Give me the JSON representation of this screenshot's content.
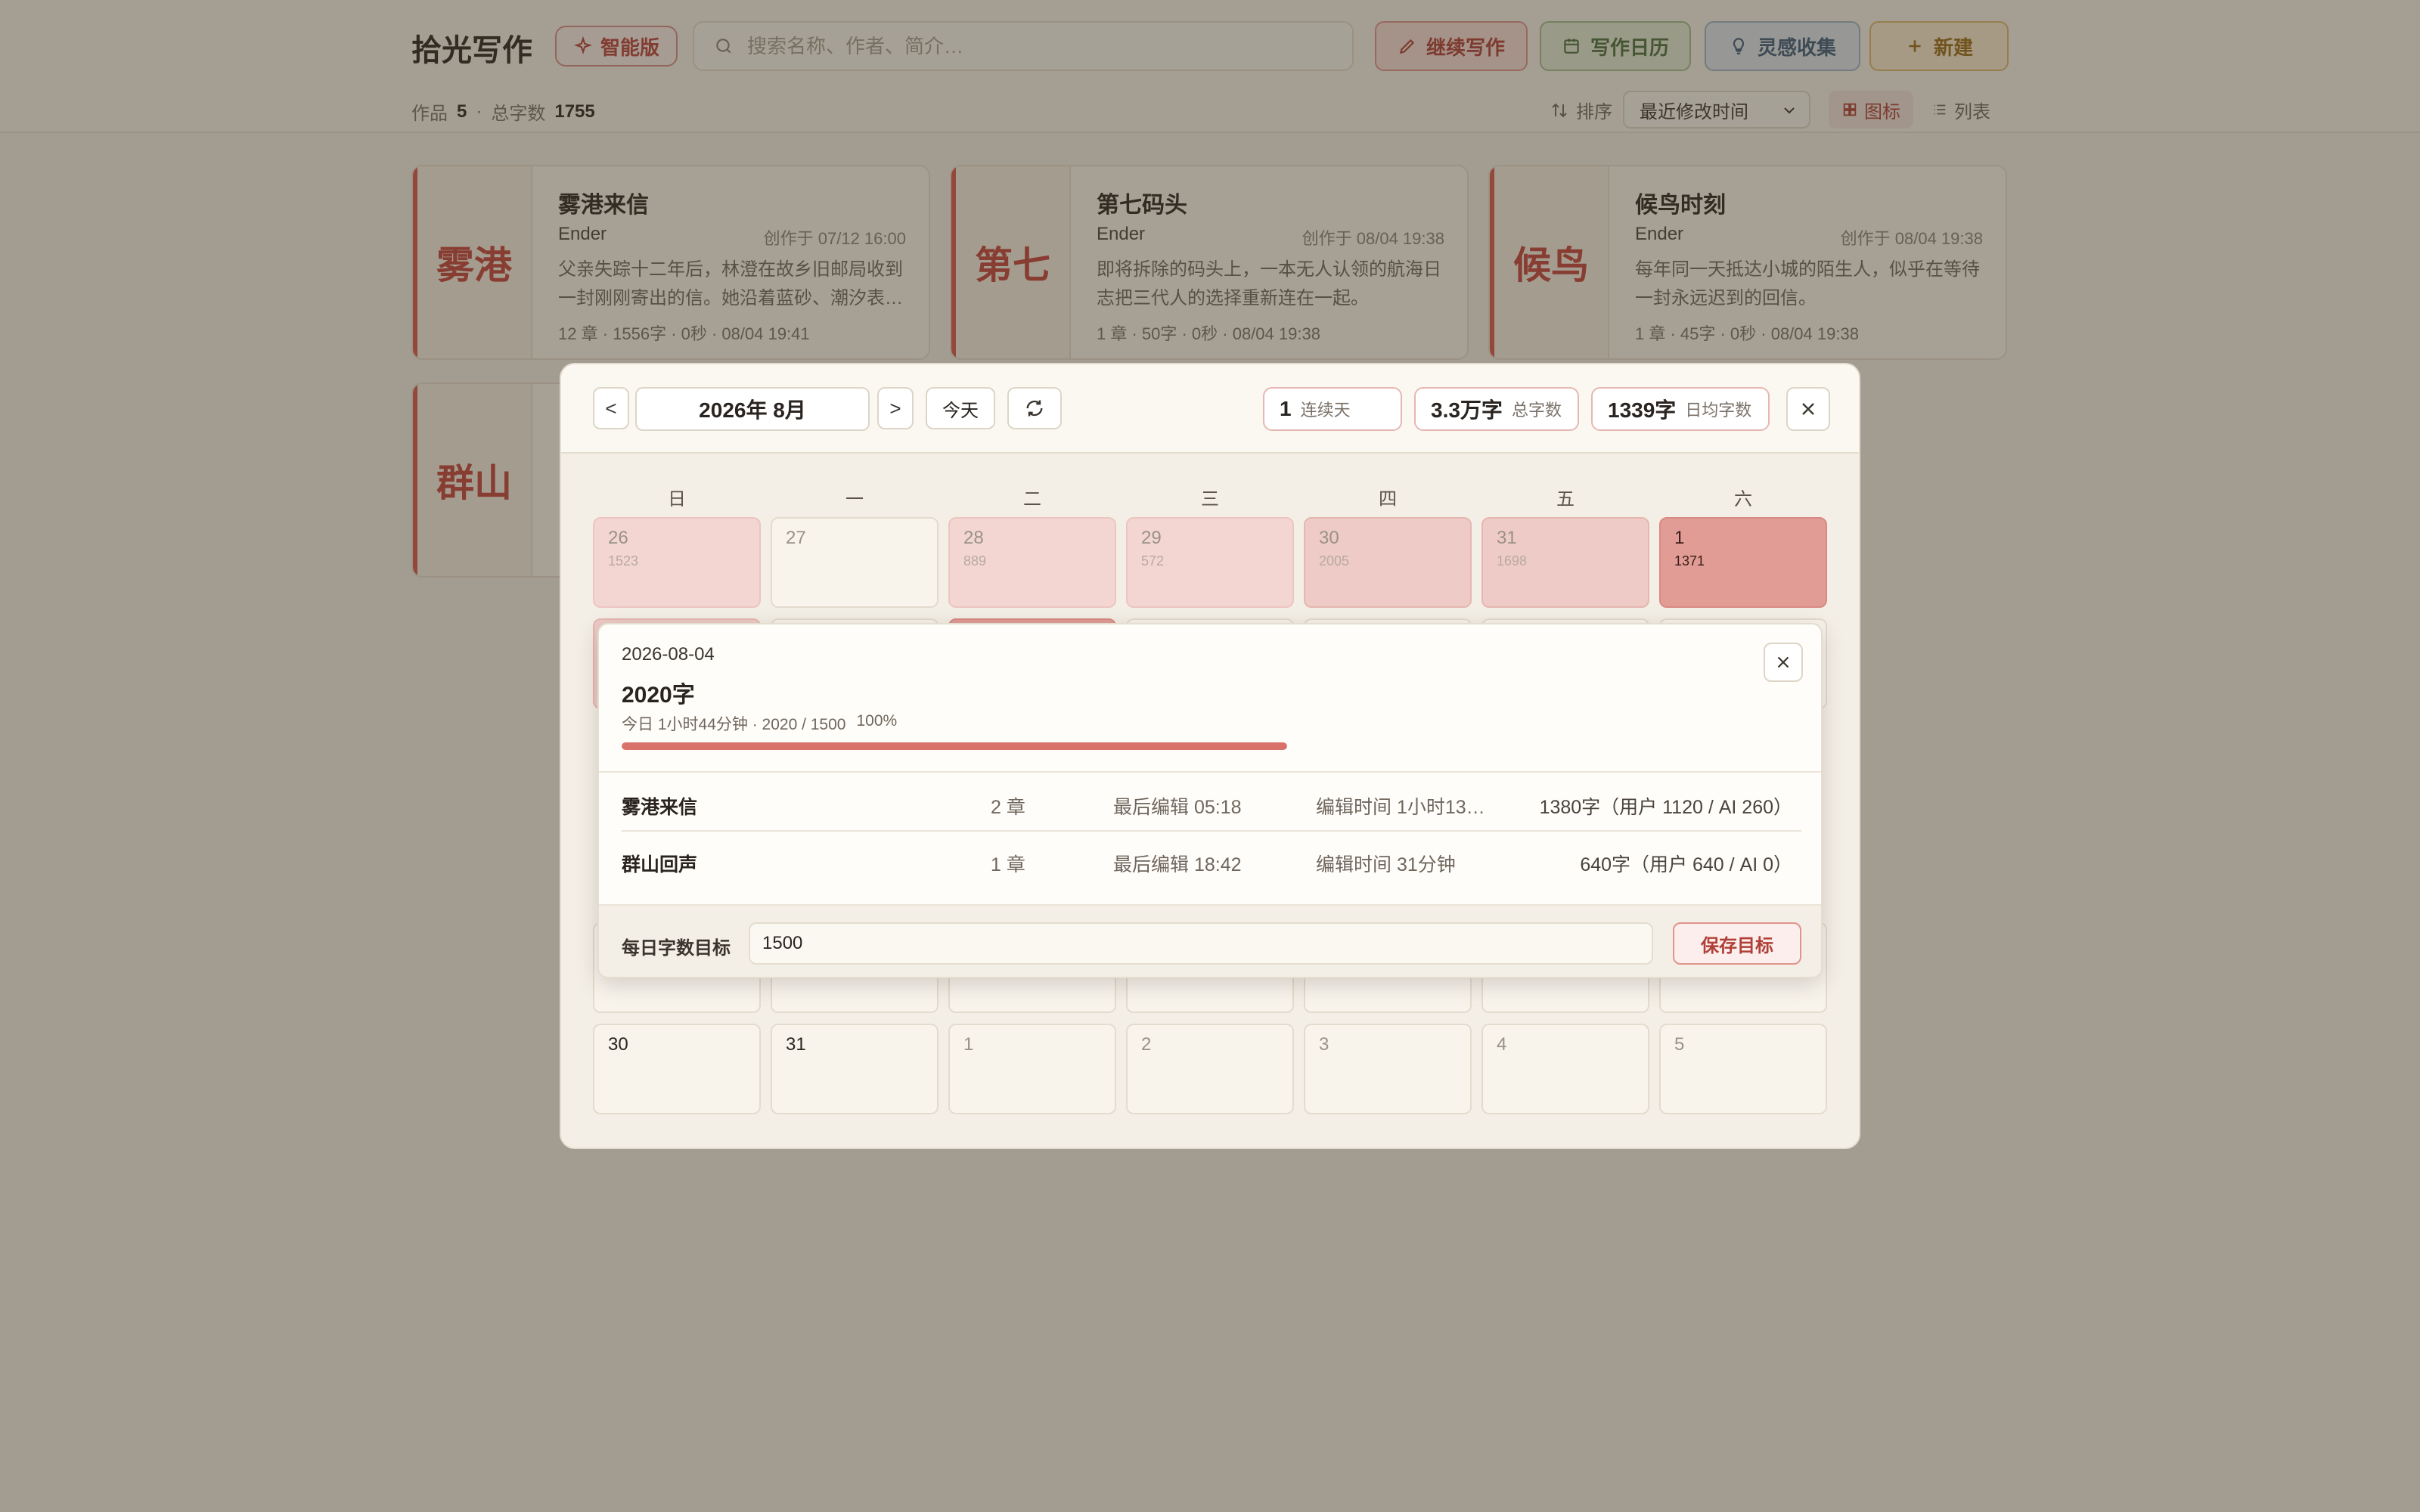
{
  "app": {
    "title": "拾光写作",
    "edition_badge": "智能版",
    "search_placeholder": "搜索名称、作者、简介…"
  },
  "toolbar": {
    "continue_label": "继续写作",
    "calendar_label": "写作日历",
    "ideas_label": "灵感收集",
    "new_label": "新建"
  },
  "stats": {
    "works_label": "作品",
    "works_count": "5",
    "words_label": "总字数",
    "words_count": "1755"
  },
  "sort": {
    "label": "排序",
    "selected": "最近修改时间"
  },
  "view": {
    "grid_label": "图标",
    "list_label": "列表"
  },
  "works": [
    {
      "cover": "雾港",
      "title": "雾港来信",
      "author": "Ender",
      "created": "创作于 07/12 16:00",
      "desc": "父亲失踪十二年后，林澄在故乡旧邮局收到一封刚刚寄出的信。她沿着蓝砂、潮汐表…",
      "meta": "12 章 · 1556字 · 0秒 · 08/04 19:41"
    },
    {
      "cover": "第七",
      "title": "第七码头",
      "author": "Ender",
      "created": "创作于 08/04 19:38",
      "desc": "即将拆除的码头上，一本无人认领的航海日志把三代人的选择重新连在一起。",
      "meta": "1 章 · 50字 · 0秒 · 08/04 19:38"
    },
    {
      "cover": "候鸟",
      "title": "候鸟时刻",
      "author": "Ender",
      "created": "创作于 08/04 19:38",
      "desc": "每年同一天抵达小城的陌生人，似乎在等待一封永远迟到的回信。",
      "meta": "1 章 · 45字 · 0秒 · 08/04 19:38"
    },
    {
      "cover": "群山",
      "title": "",
      "author": "",
      "created": "",
      "desc": "",
      "meta": ""
    }
  ],
  "calendar": {
    "prev_label": "<",
    "next_label": ">",
    "month": "2026年 8月",
    "today_label": "今天",
    "streak_value": "1",
    "streak_label": "连续天",
    "total_value": "3.3万字",
    "total_label": "总字数",
    "avg_value": "1339字",
    "avg_label": "日均字数",
    "weekdays": [
      "日",
      "一",
      "二",
      "三",
      "四",
      "五",
      "六"
    ],
    "week1": [
      {
        "day": "26",
        "count": "1523"
      },
      {
        "day": "27",
        "count": ""
      },
      {
        "day": "28",
        "count": "889"
      },
      {
        "day": "29",
        "count": "572"
      },
      {
        "day": "30",
        "count": "2005"
      },
      {
        "day": "31",
        "count": "1698"
      },
      {
        "day": "1",
        "count": "1371"
      }
    ],
    "last_week": [
      {
        "day": "30"
      },
      {
        "day": "31"
      },
      {
        "day": "1"
      },
      {
        "day": "2"
      },
      {
        "day": "3"
      },
      {
        "day": "4"
      },
      {
        "day": "5"
      }
    ]
  },
  "day_detail": {
    "date": "2026-08-04",
    "total": "2020字",
    "summary": "今日 1小时44分钟 · 2020 / 1500",
    "percent_label": "100%",
    "progress": 1.0,
    "rows": [
      {
        "title": "雾港来信",
        "chapters": "2 章",
        "last_edit": "最后编辑 05:18",
        "edit_time": "编辑时间 1小时13…",
        "words": "1380字（用户 1120 / AI 260）"
      },
      {
        "title": "群山回声",
        "chapters": "1 章",
        "last_edit": "最后编辑 18:42",
        "edit_time": "编辑时间 31分钟",
        "words": "640字（用户 640 / AI 0）"
      }
    ],
    "goal_label": "每日字数目标",
    "goal_value": "1500",
    "save_label": "保存目标"
  }
}
